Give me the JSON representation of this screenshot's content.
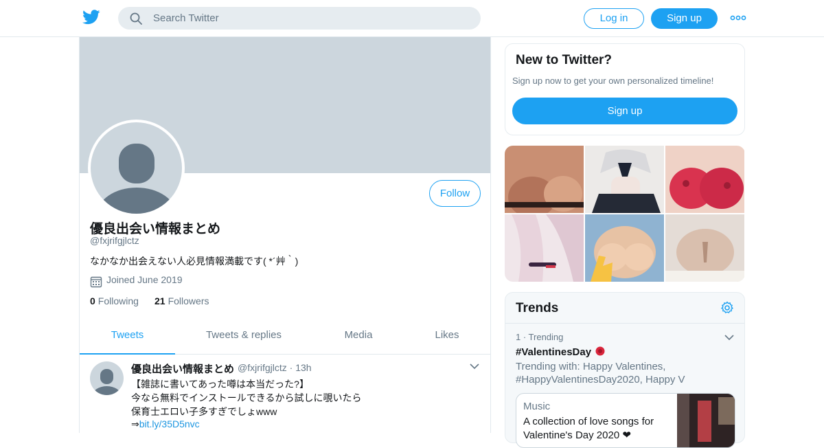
{
  "topbar": {
    "logo": "twitter-bird-icon",
    "search_placeholder": "Search Twitter",
    "login_label": "Log in",
    "signup_label": "Sign up",
    "more_icon": "more-dots-icon",
    "accent_color": "#1da1f2"
  },
  "profile": {
    "display_name": "優良出会い情報まとめ",
    "handle": "@fxjrifgjlctz",
    "bio": "なかなか出会えない人必見情報満載です( *´艸｀)",
    "joined": "Joined June 2019",
    "following_count": "0",
    "following_label": "Following",
    "followers_count": "21",
    "followers_label": "Followers",
    "follow_label": "Follow"
  },
  "tabs": [
    {
      "label": "Tweets",
      "active": true
    },
    {
      "label": "Tweets & replies",
      "active": false
    },
    {
      "label": "Media",
      "active": false
    },
    {
      "label": "Likes",
      "active": false
    }
  ],
  "tweet": {
    "name": "優良出会い情報まとめ",
    "handle_time": "@fxjrifgjlctz · 13h",
    "lines": [
      "【雑誌に書いてあった噂は本当だった?】",
      "今なら無料でインストールできるから試しに覗いたら",
      "保育士エロい子多すぎでしょwww"
    ],
    "link_prefix": "⇒",
    "link": "bit.ly/35D5nvc"
  },
  "new_to_twitter": {
    "title": "New to Twitter?",
    "subtitle": "Sign up now to get your own personalized timeline!",
    "signup_label": "Sign up"
  },
  "media_grid": {
    "tiles": [
      "#c98f73",
      "#e8e6e4",
      "#d9334f",
      "#eadbe0",
      "#c8c4b6",
      "#d9c3b5"
    ]
  },
  "trends": {
    "title": "Trends",
    "settings_icon": "gear-icon",
    "items": [
      {
        "meta": "1 · Trending",
        "tag": "#ValentinesDay",
        "with": "Trending with: Happy Valentines, #HappyValentinesDay2020, Happy V"
      }
    ],
    "moment": {
      "category": "Music",
      "title": "A collection of love songs for Valentine's Day 2020 ❤"
    }
  }
}
